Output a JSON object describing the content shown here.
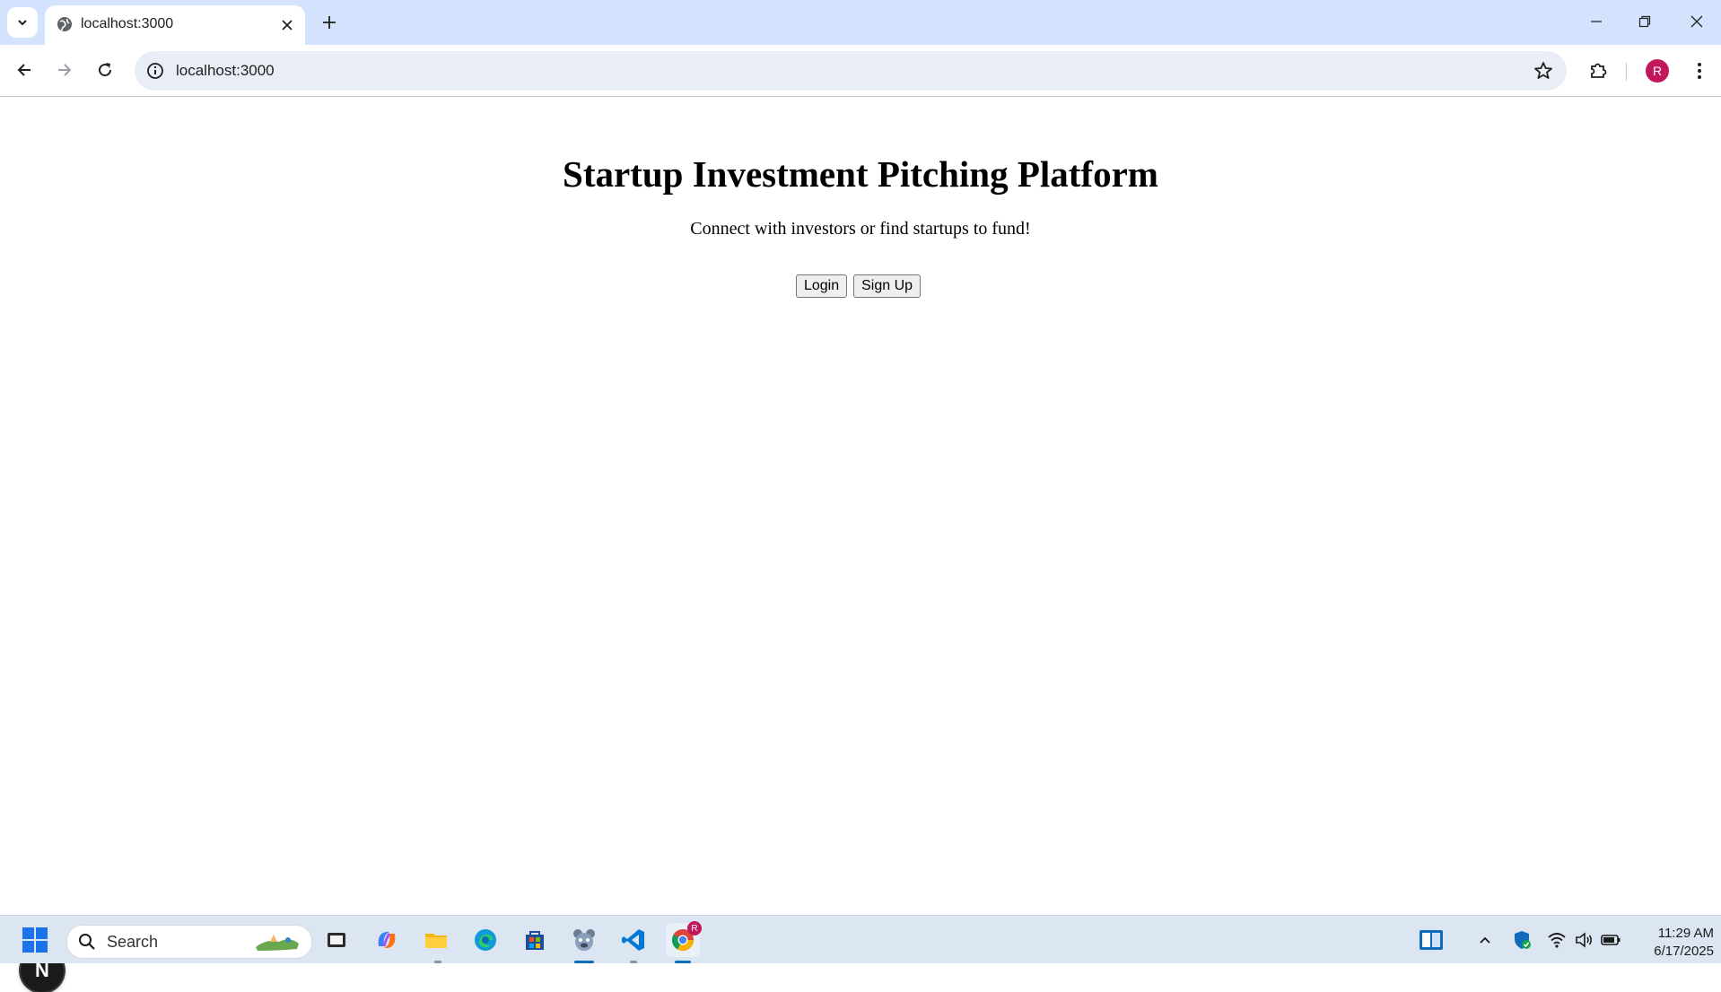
{
  "browser": {
    "tab_title": "localhost:3000",
    "url": "localhost:3000",
    "profile_initial": "R"
  },
  "page": {
    "title": "Startup Investment Pitching Platform",
    "subtitle": "Connect with investors or find startups to fund!",
    "login_label": "Login",
    "signup_label": "Sign Up",
    "dev_badge_letter": "N"
  },
  "taskbar": {
    "search_placeholder": "Search",
    "time": "11:29 AM",
    "date": "6/17/2025",
    "chrome_badge": "R"
  },
  "colors": {
    "tabstrip": "#d3e3fd",
    "omnibox": "#e9eef6",
    "avatar": "#c2185b",
    "taskbar": "#dce6f3"
  }
}
